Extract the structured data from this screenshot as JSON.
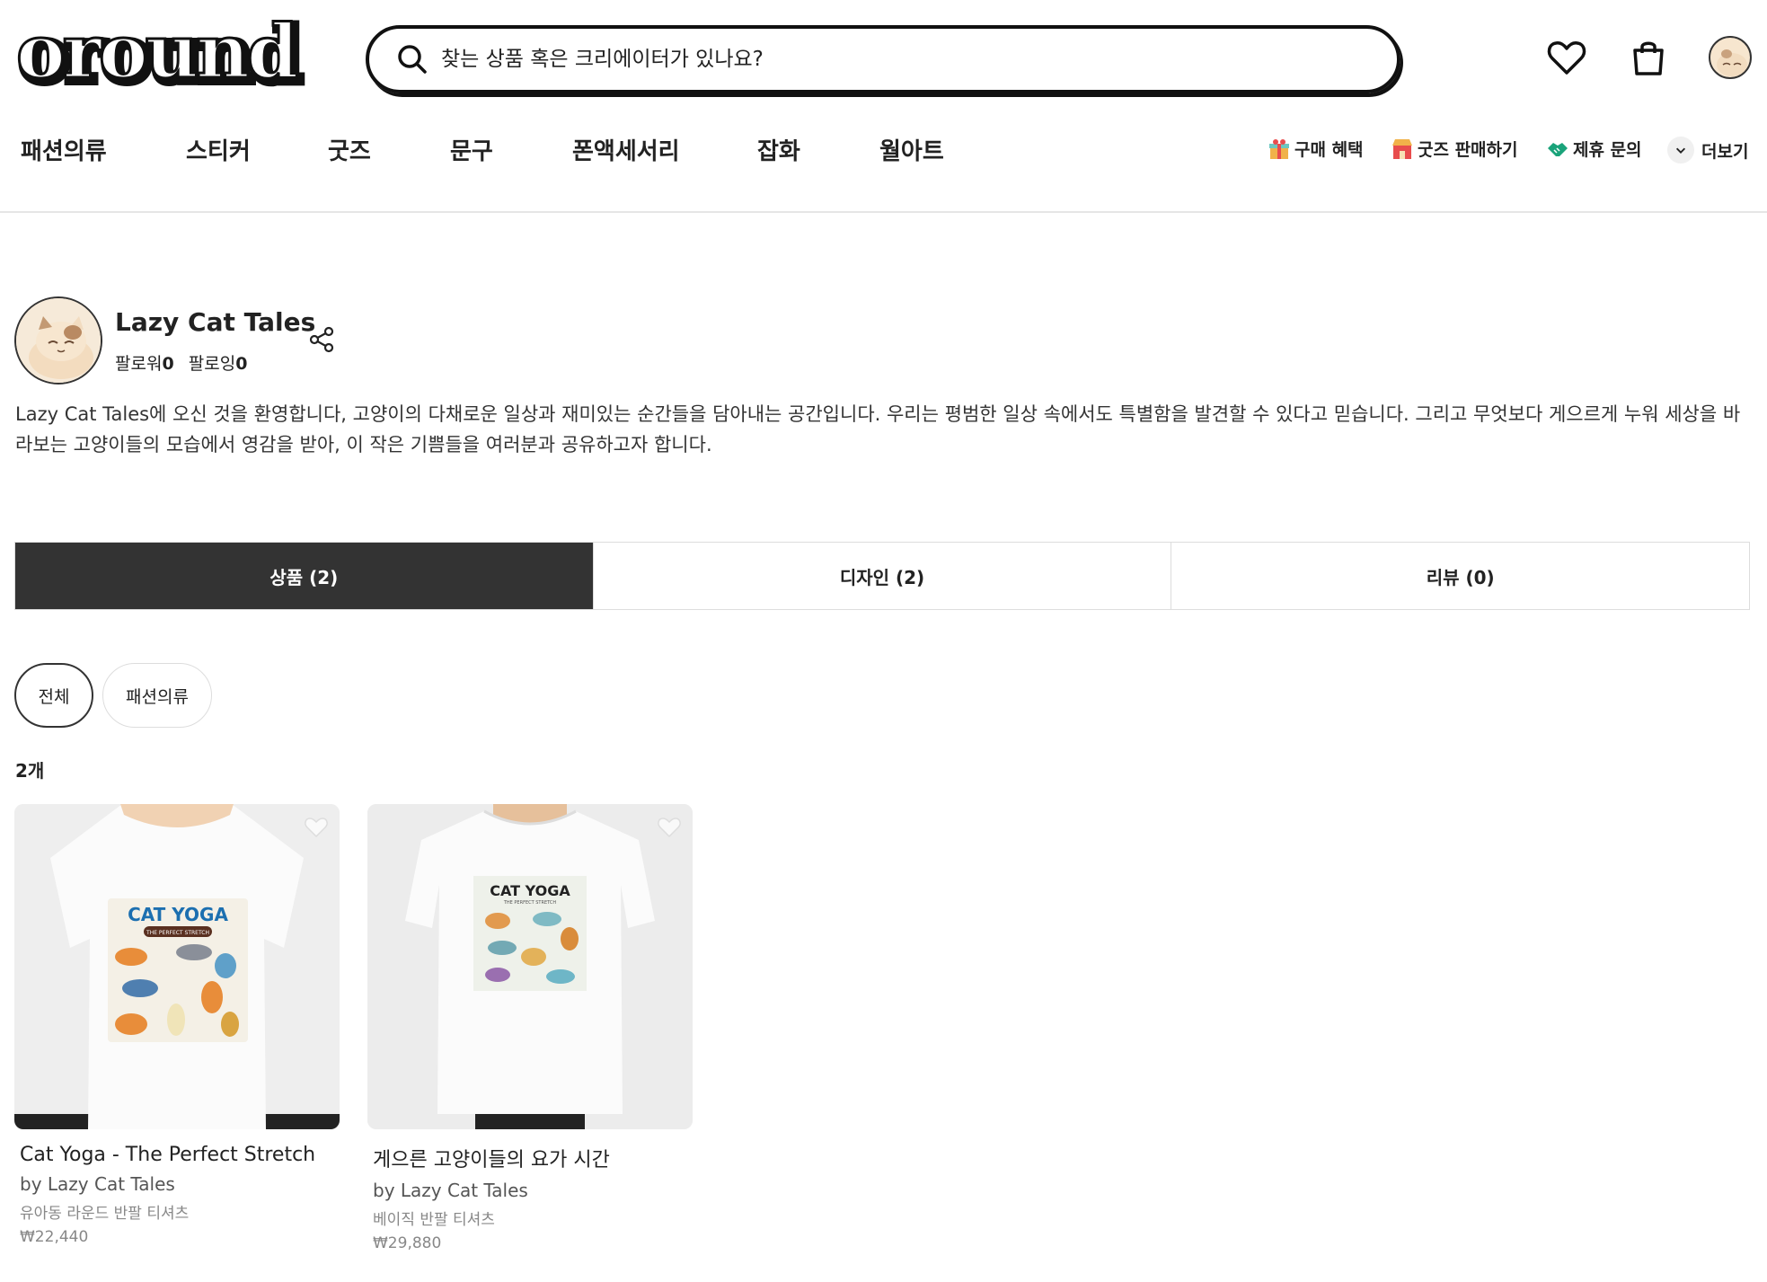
{
  "header": {
    "logo_text": "oround",
    "search_placeholder": "찾는 상품 혹은 크리에이터가 있나요?"
  },
  "nav": {
    "categories": [
      "패션의류",
      "스티커",
      "굿즈",
      "문구",
      "폰액세서리",
      "잡화",
      "월아트"
    ],
    "right_links": [
      "구매 혜택",
      "굿즈 판매하기",
      "제휴 문의",
      "더보기"
    ]
  },
  "profile": {
    "name": "Lazy Cat Tales",
    "followers_label": "팔로워",
    "followers": "0",
    "following_label": "팔로잉",
    "following": "0",
    "bio": "Lazy Cat Tales에 오신 것을 환영합니다, 고양이의 다채로운 일상과 재미있는 순간들을 담아내는 공간입니다. 우리는 평범한 일상 속에서도 특별함을 발견할 수 있다고 믿습니다. 그리고 무엇보다 게으르게 누워 세상을 바라보는 고양이들의 모습에서 영감을 받아, 이 작은 기쁨들을 여러분과 공유하고자 합니다."
  },
  "tabs": [
    "상품 (2)",
    "디자인 (2)",
    "리뷰 (0)"
  ],
  "filters": [
    "전체",
    "패션의류"
  ],
  "count_label": "2개",
  "products": [
    {
      "title": "Cat Yoga - The Perfect Stretch",
      "by": "by Lazy Cat Tales",
      "type": "유아동 라운드 반팔 티셔츠",
      "price": "₩22,440",
      "print_title": "CAT YOGA",
      "print_subtitle": "THE PERFECT STRETCH"
    },
    {
      "title": "게으른 고양이들의 요가 시간",
      "by": "by Lazy Cat Tales",
      "type": "베이직 반팔 티셔츠",
      "price": "₩29,880",
      "print_title": "CAT YOGA",
      "print_subtitle": "THE PERFECT STRETCH"
    }
  ],
  "colors": {
    "accent_dark": "#333333",
    "text": "#222222",
    "muted": "#888888"
  }
}
